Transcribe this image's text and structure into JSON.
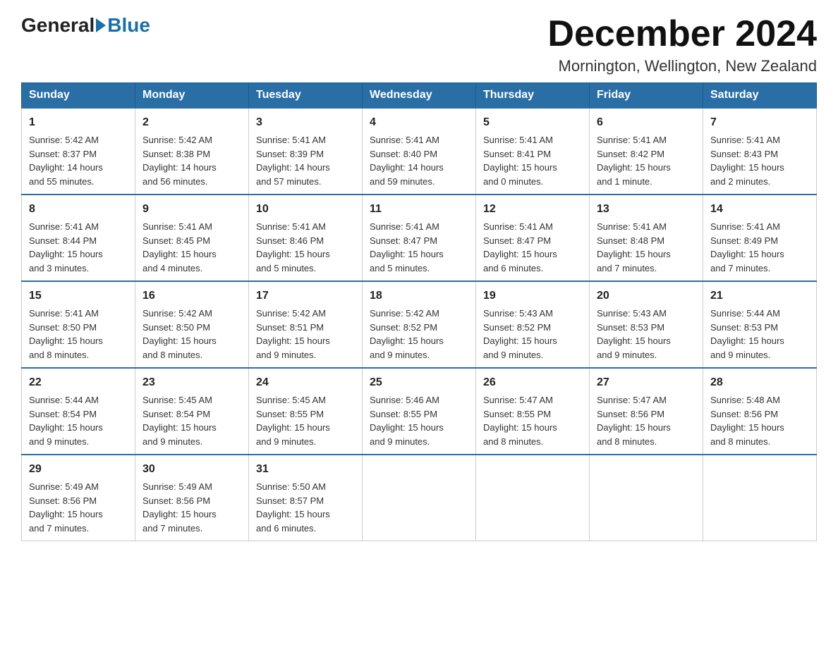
{
  "logo": {
    "general": "General",
    "blue": "Blue"
  },
  "title": "December 2024",
  "location": "Mornington, Wellington, New Zealand",
  "days_of_week": [
    "Sunday",
    "Monday",
    "Tuesday",
    "Wednesday",
    "Thursday",
    "Friday",
    "Saturday"
  ],
  "weeks": [
    [
      {
        "day": "1",
        "sunrise": "5:42 AM",
        "sunset": "8:37 PM",
        "daylight": "14 hours and 55 minutes."
      },
      {
        "day": "2",
        "sunrise": "5:42 AM",
        "sunset": "8:38 PM",
        "daylight": "14 hours and 56 minutes."
      },
      {
        "day": "3",
        "sunrise": "5:41 AM",
        "sunset": "8:39 PM",
        "daylight": "14 hours and 57 minutes."
      },
      {
        "day": "4",
        "sunrise": "5:41 AM",
        "sunset": "8:40 PM",
        "daylight": "14 hours and 59 minutes."
      },
      {
        "day": "5",
        "sunrise": "5:41 AM",
        "sunset": "8:41 PM",
        "daylight": "15 hours and 0 minutes."
      },
      {
        "day": "6",
        "sunrise": "5:41 AM",
        "sunset": "8:42 PM",
        "daylight": "15 hours and 1 minute."
      },
      {
        "day": "7",
        "sunrise": "5:41 AM",
        "sunset": "8:43 PM",
        "daylight": "15 hours and 2 minutes."
      }
    ],
    [
      {
        "day": "8",
        "sunrise": "5:41 AM",
        "sunset": "8:44 PM",
        "daylight": "15 hours and 3 minutes."
      },
      {
        "day": "9",
        "sunrise": "5:41 AM",
        "sunset": "8:45 PM",
        "daylight": "15 hours and 4 minutes."
      },
      {
        "day": "10",
        "sunrise": "5:41 AM",
        "sunset": "8:46 PM",
        "daylight": "15 hours and 5 minutes."
      },
      {
        "day": "11",
        "sunrise": "5:41 AM",
        "sunset": "8:47 PM",
        "daylight": "15 hours and 5 minutes."
      },
      {
        "day": "12",
        "sunrise": "5:41 AM",
        "sunset": "8:47 PM",
        "daylight": "15 hours and 6 minutes."
      },
      {
        "day": "13",
        "sunrise": "5:41 AM",
        "sunset": "8:48 PM",
        "daylight": "15 hours and 7 minutes."
      },
      {
        "day": "14",
        "sunrise": "5:41 AM",
        "sunset": "8:49 PM",
        "daylight": "15 hours and 7 minutes."
      }
    ],
    [
      {
        "day": "15",
        "sunrise": "5:41 AM",
        "sunset": "8:50 PM",
        "daylight": "15 hours and 8 minutes."
      },
      {
        "day": "16",
        "sunrise": "5:42 AM",
        "sunset": "8:50 PM",
        "daylight": "15 hours and 8 minutes."
      },
      {
        "day": "17",
        "sunrise": "5:42 AM",
        "sunset": "8:51 PM",
        "daylight": "15 hours and 9 minutes."
      },
      {
        "day": "18",
        "sunrise": "5:42 AM",
        "sunset": "8:52 PM",
        "daylight": "15 hours and 9 minutes."
      },
      {
        "day": "19",
        "sunrise": "5:43 AM",
        "sunset": "8:52 PM",
        "daylight": "15 hours and 9 minutes."
      },
      {
        "day": "20",
        "sunrise": "5:43 AM",
        "sunset": "8:53 PM",
        "daylight": "15 hours and 9 minutes."
      },
      {
        "day": "21",
        "sunrise": "5:44 AM",
        "sunset": "8:53 PM",
        "daylight": "15 hours and 9 minutes."
      }
    ],
    [
      {
        "day": "22",
        "sunrise": "5:44 AM",
        "sunset": "8:54 PM",
        "daylight": "15 hours and 9 minutes."
      },
      {
        "day": "23",
        "sunrise": "5:45 AM",
        "sunset": "8:54 PM",
        "daylight": "15 hours and 9 minutes."
      },
      {
        "day": "24",
        "sunrise": "5:45 AM",
        "sunset": "8:55 PM",
        "daylight": "15 hours and 9 minutes."
      },
      {
        "day": "25",
        "sunrise": "5:46 AM",
        "sunset": "8:55 PM",
        "daylight": "15 hours and 9 minutes."
      },
      {
        "day": "26",
        "sunrise": "5:47 AM",
        "sunset": "8:55 PM",
        "daylight": "15 hours and 8 minutes."
      },
      {
        "day": "27",
        "sunrise": "5:47 AM",
        "sunset": "8:56 PM",
        "daylight": "15 hours and 8 minutes."
      },
      {
        "day": "28",
        "sunrise": "5:48 AM",
        "sunset": "8:56 PM",
        "daylight": "15 hours and 8 minutes."
      }
    ],
    [
      {
        "day": "29",
        "sunrise": "5:49 AM",
        "sunset": "8:56 PM",
        "daylight": "15 hours and 7 minutes."
      },
      {
        "day": "30",
        "sunrise": "5:49 AM",
        "sunset": "8:56 PM",
        "daylight": "15 hours and 7 minutes."
      },
      {
        "day": "31",
        "sunrise": "5:50 AM",
        "sunset": "8:57 PM",
        "daylight": "15 hours and 6 minutes."
      },
      null,
      null,
      null,
      null
    ]
  ],
  "labels": {
    "sunrise": "Sunrise:",
    "sunset": "Sunset:",
    "daylight": "Daylight:"
  }
}
